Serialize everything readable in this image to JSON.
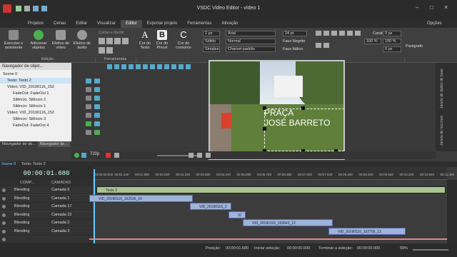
{
  "window": {
    "title": "VSDC Video Editor - vídeo 1",
    "options_label": "Opções"
  },
  "tabs": [
    "Projetos",
    "Cenas",
    "Editar",
    "Visualizar",
    "Editor",
    "Exportar projeto",
    "Ferramentas",
    "Ativação"
  ],
  "ribbon": {
    "assistant": "Executar o assistente",
    "add_objects": "Adicionar objetos",
    "video_effects": "Efeitos de vídeo",
    "audio_effects": "Efeitos de áudio",
    "cut_split": "Cortar e dividir",
    "edit_group": "Edição",
    "tools_group": "Ferramentas",
    "text_color": "Cor do Texto",
    "brush_color": "Cor do Pincel",
    "outline_color": "Cor do contorno",
    "line_width": "1 px",
    "line_style": "Sólido",
    "fill_style": "Simples",
    "font": "Arial",
    "font_mode": "Normal",
    "charset": "Charset padrão",
    "font_size": "24 pt",
    "bold": "Faux Negrito",
    "italic": "Faux Itálico",
    "char_label": "Caráter",
    "spacing1": "0 px",
    "pct1": "100 %",
    "pct2": "100 %",
    "spacing2": "0 px",
    "paragraph": "Parágrafo"
  },
  "object_navigator": {
    "title": "Navegador de objet...",
    "items": [
      {
        "label": "Scene 0",
        "depth": 0
      },
      {
        "label": "Texto: Texto 2",
        "depth": 1
      },
      {
        "label": "Vídeo: VID_20190116_152",
        "depth": 1
      },
      {
        "label": "FadeOut: FadeOut 1",
        "depth": 2
      },
      {
        "label": "Silêncio: Silêncio 2",
        "depth": 2
      },
      {
        "label": "Silêncio: Silêncio 1",
        "depth": 2
      },
      {
        "label": "Vídeo: VID_20190116_152",
        "depth": 1
      },
      {
        "label": "Silêncio: Silêncio 3",
        "depth": 2
      },
      {
        "label": "FadeOut: FadeOut 4",
        "depth": 2
      }
    ],
    "tabs": [
      "Navegador de ob...",
      "Navegador de..."
    ]
  },
  "preview": {
    "text_line1": "PRAÇA",
    "text_line2": "JOSÉ BARRETO",
    "zoom": "720p"
  },
  "right_tabs": [
    "Janela de dados de base",
    "Janela de recursos"
  ],
  "timeline": {
    "tabs": [
      "Scene 0",
      "Texto: Texto 2"
    ],
    "timecode": "00:00:01.680",
    "header_com": "COMP...",
    "header_layers": "CAMADAS",
    "ticks": [
      "00:00:00.000",
      "00:01.240",
      "00:01.880",
      "00:02.520",
      "00:03.160",
      "00:03.800",
      "00:04.440",
      "00:05.080",
      "00:05.720",
      "00:06.360",
      "00:07.000",
      "00:07.640",
      "00:08.280",
      "00:08.920",
      "00:09.560",
      "00:10.200",
      "00:10.840",
      "00:11.480"
    ],
    "tracks": [
      {
        "blend": "Blending",
        "layer": "Camada 5",
        "clip": "Texto 2"
      },
      {
        "blend": "Blending",
        "layer": "Camada 1",
        "clip": "VID_20190116_152536_10"
      },
      {
        "blend": "Blending",
        "layer": "Camada 17",
        "clip": "VID_20190116_1"
      },
      {
        "blend": "Blending",
        "layer": "Camada 22",
        "clip": "VI"
      },
      {
        "blend": "Blending",
        "layer": "Camada 2",
        "clip": "VID_20190116_152643_12"
      },
      {
        "blend": "Blending",
        "layer": "Camada 3",
        "clip": "VID_20190116_152756_13"
      },
      {
        "blend": "",
        "layer": "",
        "clip": ""
      }
    ]
  },
  "status": {
    "position_label": "Posição:",
    "position": "00:00:01.680",
    "start_label": "Iniciar seleção:",
    "start": "00:00:00.000",
    "end_label": "Terminar a seleção:",
    "end": "00:00:00.000",
    "zoom": "59%"
  },
  "colors": {
    "accent_green": "#4caf50",
    "text_clip": "#a9c48e",
    "video_clip": "#9fb2d9",
    "active_tab": "#4a4a4a"
  }
}
